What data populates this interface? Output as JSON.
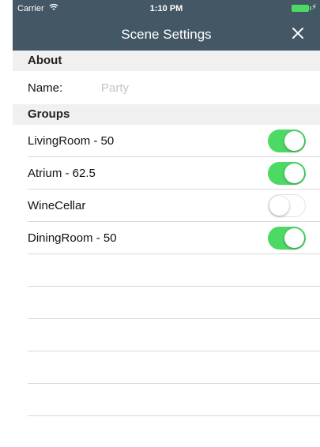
{
  "status_bar": {
    "carrier": "Carrier",
    "time": "1:10 PM"
  },
  "nav": {
    "title": "Scene Settings",
    "close_icon": "close-icon"
  },
  "about": {
    "header": "About",
    "name_label": "Name:",
    "name_value": "",
    "name_placeholder": "Party"
  },
  "groups": {
    "header": "Groups",
    "items": [
      {
        "label": "LivingRoom - 50",
        "enabled": true
      },
      {
        "label": "Atrium - 62.5",
        "enabled": true
      },
      {
        "label": "WineCellar",
        "enabled": false
      },
      {
        "label": "DiningRoom - 50",
        "enabled": true
      }
    ]
  },
  "colors": {
    "nav_background": "#445765",
    "toggle_on": "#4cd964",
    "section_background": "#f0f0f0"
  }
}
